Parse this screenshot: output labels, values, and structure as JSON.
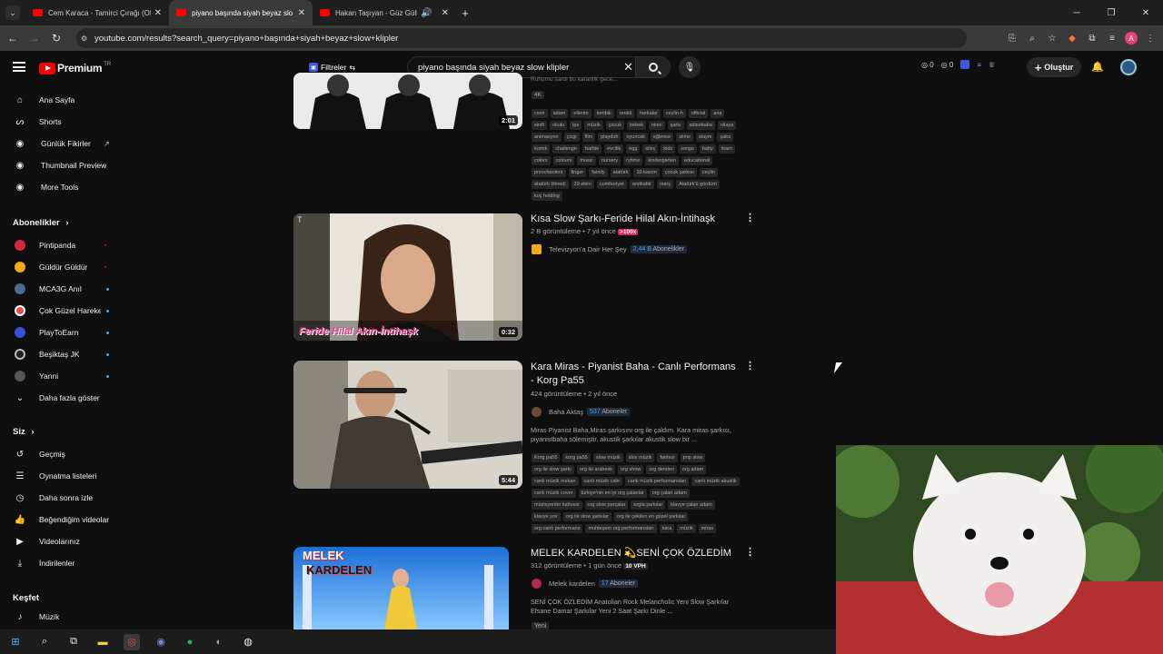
{
  "browser": {
    "tabs": [
      {
        "title": "Cem Karaca - Tamirci Çırağı (Offi",
        "active": false
      },
      {
        "title": "piyano başında siyah beyaz slo",
        "active": true
      },
      {
        "title": "Hakan Taşıyan - Güz Gülleri",
        "active": false
      }
    ],
    "url": "youtube.com/results?search_query=piyano+başında+siyah+beyaz+slow+klipler",
    "profile_letter": "A"
  },
  "header": {
    "logo_text": "Premium",
    "logo_region": "TR",
    "filters_label": "Filtreler",
    "search_value": "piyano başında siyah beyaz slow klipler",
    "counter1": "0",
    "counter2": "0",
    "create_label": "Oluştur"
  },
  "sidebar": {
    "main": [
      "Ana Sayfa",
      "Shorts",
      "Günlük Fikirler",
      "Thumbnail Preview",
      "More Tools"
    ],
    "subs_header": "Abonelikler",
    "subs": [
      "Pintipanda",
      "Güldür Güldür",
      "MCA3G Anıl",
      "Çok Güzel Hareketler",
      "PlayToEarn",
      "Beşiktaş JK",
      "Yanni"
    ],
    "show_more": "Daha fazla göster",
    "you_header": "Siz",
    "you": [
      "Geçmiş",
      "Oynatma listeleri",
      "Daha sonra izle",
      "Beğendiğim videolar",
      "Videolarınız",
      "İndirilenler"
    ],
    "explore_header": "Keşfet",
    "explore": [
      "Müzik"
    ]
  },
  "results": [
    {
      "duration": "2:01",
      "partial_line": "Ruhumu sardı bu karanlık gece... ",
      "badge": "4K",
      "tags": [
        "cevir",
        "adam",
        "ellerim",
        "tombik",
        "renkli",
        "harkalar",
        "ceylin-h",
        "official",
        "ana",
        "sinifi",
        "okulu",
        "lps",
        "müzik",
        "çocuk",
        "bebek",
        "ninni",
        "şarkı",
        "adisebaba",
        "nilaya",
        "animasyon",
        "çizgi",
        "film",
        "playdoh",
        "oyuncak",
        "eğlence",
        "slime",
        "slaym",
        "şaka",
        "komik",
        "challenge",
        "barbie",
        "evcilik",
        "egg",
        "sileç",
        "kids",
        "songs",
        "baby",
        "learn",
        "colors",
        "colours",
        "music",
        "nursery",
        "ryhme",
        "kindergarten",
        "educational",
        "preschoolers",
        "finger",
        "family",
        "atatürk",
        "10 kasım",
        "çocuk şarkısı",
        "ceylin",
        "atatürk ölmedi",
        "29 ekim",
        "cumhuriyet",
        "anıtkabir",
        "marş",
        "Atatürk'ü gördüm",
        "koç holding"
      ]
    },
    {
      "title": "Kısa Slow Şarkı-Feride Hilal Akın-İntihaşk",
      "views": "2 B görüntüleme",
      "age": "7 yıl önce",
      "badge": ">100x",
      "channel": "Televizyon'a Dair Her Şey",
      "subs": "2,44 B",
      "subs_label": "Abonelikler",
      "duration": "0:32",
      "thumb_caption": "Feride Hilal Akın-İntihaşk",
      "thumb_letter": "T"
    },
    {
      "title": "Kara Miras - Piyanist Baha - Canlı Performans - Korg Pa55",
      "views": "424 görüntüleme",
      "age": "2 yıl önce",
      "channel": "Baha Aktaş",
      "subs": "537",
      "subs_label": "Aboneler",
      "description": "Miras Piyanist Baha,Miras şarkısını org ile çaldım. Kara miras şarkısı, piyanistbaha sölemiştir. akustik şarkılar akustik slow bir ...",
      "duration": "5:44",
      "tags": [
        "Korg pa55",
        "korg pa55",
        "slow müzik",
        "slov müzik",
        "fantezi",
        "pop slow",
        "org ile slow şarkı",
        "org ile arabesk",
        "org show",
        "org dersleri",
        "org adam",
        "canlı müzik mekan",
        "canlı müzik cafe",
        "canlı müzik performansları",
        "canlı müzik akustik",
        "canlı müzik cover",
        "türkiye'nin en iyi org çalanlar",
        "org çalan adam",
        "müzisyenler kahvesi",
        "org slow parçalar",
        "orgla şarkılar",
        "klavye çalan adam",
        "klavye yov",
        "org ile slow şarkılar",
        "org ile çekilen en güzel şarkılar",
        "org canlı performans",
        "muhteşem org performansları",
        "kara",
        "müzik",
        "miras"
      ]
    },
    {
      "title": "MELEK KARDELEN 💫SENİ ÇOK ÖZLEDİM",
      "views": "312 görüntüleme",
      "age": "1 gün önce",
      "badge": "10 VPH",
      "channel": "Melek kardelen",
      "subs": "17",
      "subs_label": "Aboneler",
      "description": "SENİ ÇOK ÖZLEDİM Anatolian Rock Melancholic Yeni Slow Şarkılar Efsane Damar Şarkılar Yeni 2 Saat Şarkı Dinle ...",
      "new_badge": "Yeni",
      "thumb_caption_1": "MELEK",
      "thumb_caption_2": "KARDELEN"
    }
  ],
  "colors": {
    "accent": "#ff0000",
    "link": "#3ea6ff",
    "bg": "#0f0f0f"
  }
}
